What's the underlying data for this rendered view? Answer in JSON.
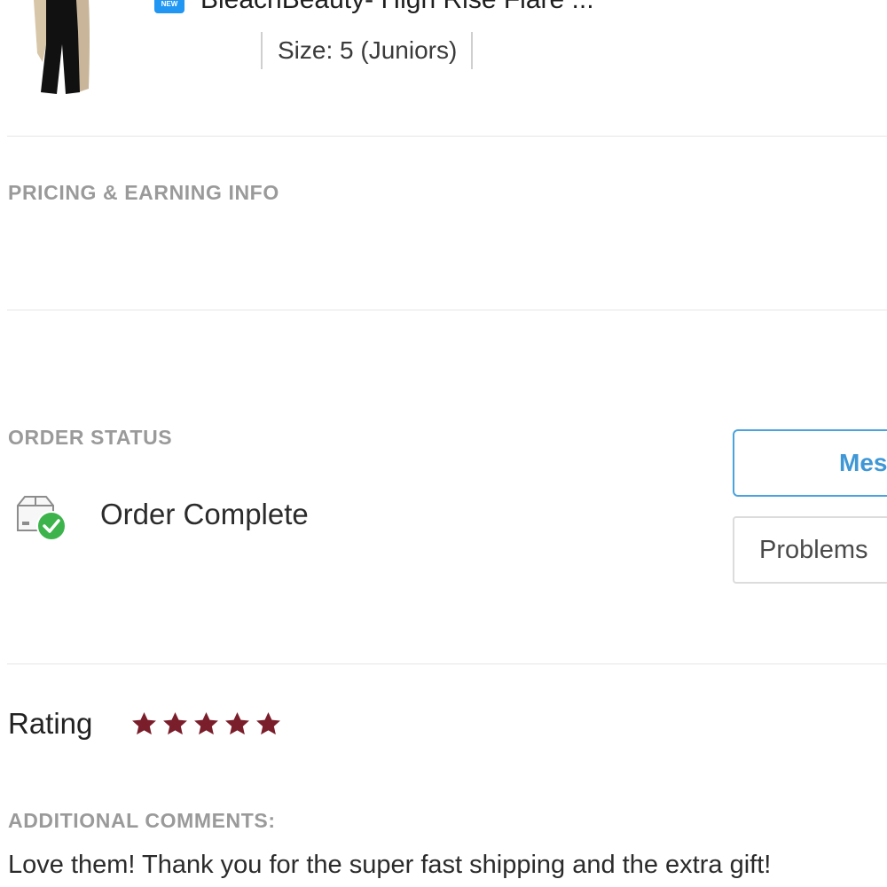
{
  "item": {
    "badge_text": "NEW",
    "title": "BleachBeauty- High Rise Flare ...",
    "size": "Size: 5 (Juniors)"
  },
  "sections": {
    "pricing_label": "PRICING & EARNING INFO",
    "order_status_label": "ORDER STATUS",
    "comments_label": "ADDITIONAL COMMENTS:"
  },
  "order_status": {
    "status_text": "Order Complete",
    "icon": "box-check-icon",
    "icon_check_color": "#3cb44b"
  },
  "actions": {
    "message_label": "Mes",
    "problems_label": "Problems",
    "message_color": "#3f97d6"
  },
  "rating": {
    "label": "Rating",
    "stars": 5,
    "max_stars": 5,
    "star_color": "#7b1e2b"
  },
  "comments": {
    "text": "Love them! Thank you for the super fast shipping and the extra gift!"
  }
}
